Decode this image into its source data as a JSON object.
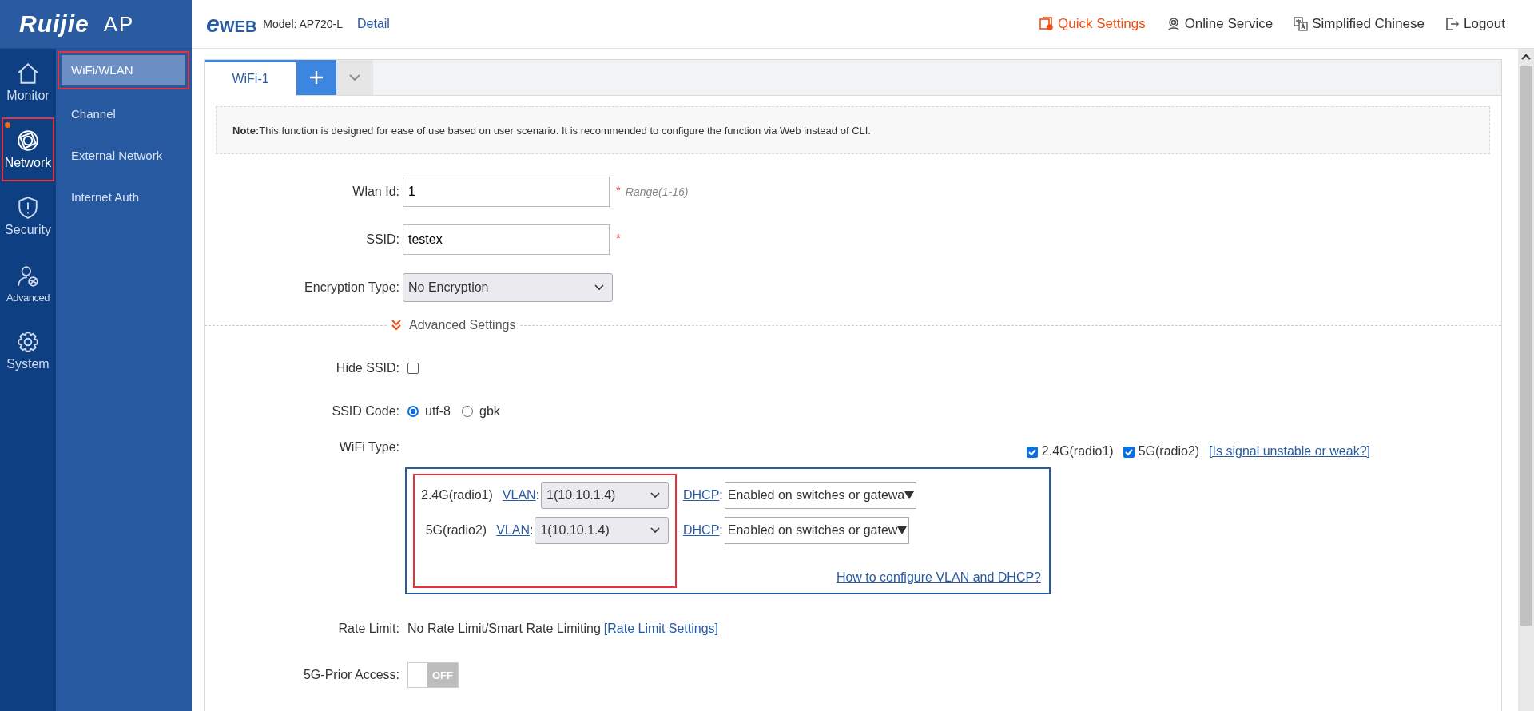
{
  "brand": {
    "logo": "Ruijie",
    "product": "AP"
  },
  "header": {
    "logo": {
      "e": "e",
      "rest": "WEB"
    },
    "model": "Model: AP720-L",
    "detail_link": "Detail",
    "actions": [
      {
        "kind": "quick",
        "label": "Quick Settings"
      },
      {
        "kind": "service",
        "label": "Online Service"
      },
      {
        "kind": "language",
        "label": "Simplified Chinese"
      },
      {
        "kind": "logout",
        "label": "Logout"
      }
    ]
  },
  "nav_rail": [
    {
      "kind": "home",
      "label": "Monitor",
      "selected": false,
      "dot": false,
      "highlighted": false
    },
    {
      "kind": "globe",
      "label": "Network",
      "selected": true,
      "dot": true,
      "highlighted": true
    },
    {
      "kind": "shield",
      "label": "Security",
      "selected": false,
      "dot": false,
      "highlighted": false
    },
    {
      "kind": "user",
      "label": "Advanced",
      "selected": false,
      "dot": false,
      "highlighted": false
    },
    {
      "kind": "gear",
      "label": "System",
      "selected": false,
      "dot": false,
      "highlighted": false
    }
  ],
  "submenu": [
    {
      "label": "WiFi/WLAN",
      "selected": true,
      "highlighted": true
    },
    {
      "label": "Channel",
      "selected": false,
      "highlighted": false
    },
    {
      "label": "External Network",
      "selected": false,
      "highlighted": false
    },
    {
      "label": "Internet Auth",
      "selected": false,
      "highlighted": false
    }
  ],
  "tabs": [
    {
      "label": "WiFi-1",
      "selected": true
    }
  ],
  "note": "**Note:**This function is designed for ease of use based on user scenario. It is recommended to configure the function via Web instead of CLI.",
  "form": {
    "wlan_id": {
      "label": "Wlan Id:",
      "value": "1",
      "required_mark": "*",
      "hint": "Range(1-16)"
    },
    "ssid": {
      "label": "SSID:",
      "value": "testex",
      "required_mark": "*"
    },
    "encryption": {
      "label": "Encryption Type:",
      "value": "No Encryption"
    },
    "advanced_toggle": "Advanced Settings",
    "hide_ssid": {
      "label": "Hide SSID:",
      "checked": false
    },
    "ssid_code": {
      "label": "SSID Code:",
      "options": [
        {
          "label": "utf-8",
          "selected": true
        },
        {
          "label": "gbk",
          "selected": false
        }
      ]
    },
    "wifi_type": {
      "label": "WiFi Type:",
      "radios": [
        {
          "label": "2.4G(radio1)",
          "checked": true
        },
        {
          "label": "5G(radio2)",
          "checked": true
        }
      ],
      "signal_link": "[Is signal unstable or weak?]",
      "highlighted": true,
      "rows": [
        {
          "radio": "2.4G(radio1)",
          "vlan_link": "VLAN",
          "vlan_sep": ":",
          "vlan": "1(10.10.1.4)",
          "dhcp_link": "DHCP",
          "dhcp_sep": ":",
          "dhcp": "Enabled on switches or gatewa"
        },
        {
          "radio": "5G(radio2)",
          "vlan_link": "VLAN",
          "vlan_sep": ":",
          "vlan": "1(10.10.1.4)",
          "dhcp_link": "DHCP",
          "dhcp_sep": ":",
          "dhcp": "Enabled on switches or gatew"
        }
      ],
      "help_link": "How to configure VLAN and DHCP?"
    },
    "rate_limit": {
      "label": "Rate Limit:",
      "value": "No Rate Limit/Smart Rate Limiting",
      "link": "[Rate Limit Settings]"
    },
    "prior_access": {
      "label": "5G-Prior Access:",
      "on": false,
      "text": "OFF"
    }
  }
}
